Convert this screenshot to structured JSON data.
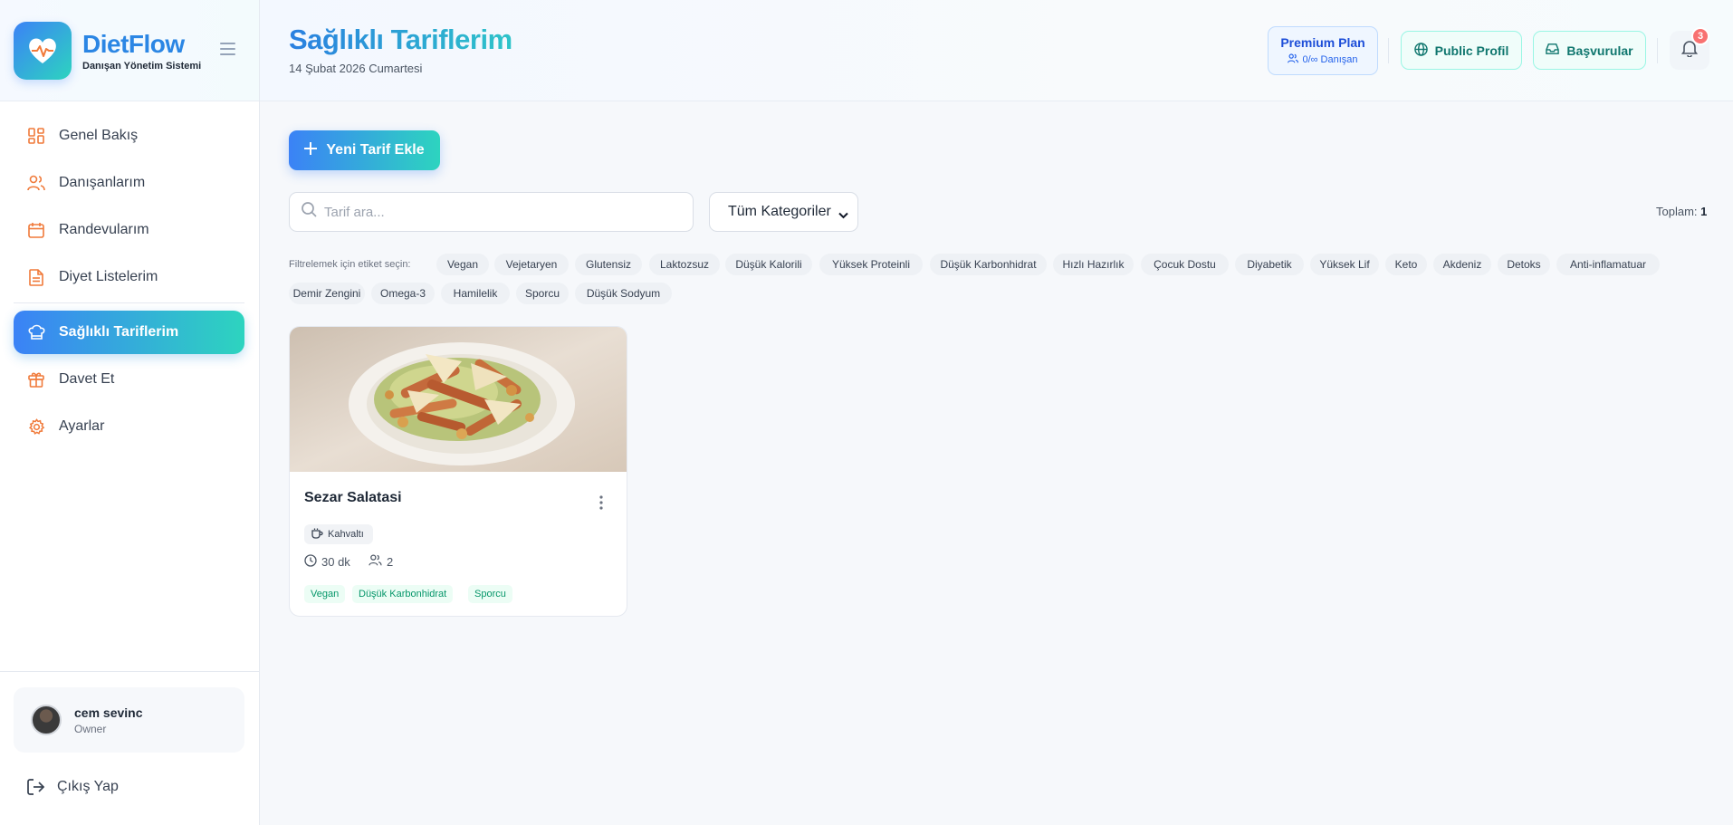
{
  "app": {
    "name": "DietFlow",
    "subtitle": "Danışan Yönetim Sistemi"
  },
  "sidebar": {
    "items": [
      {
        "label": "Genel Bakış",
        "icon": "dashboard-icon"
      },
      {
        "label": "Danışanlarım",
        "icon": "users-icon"
      },
      {
        "label": "Randevularım",
        "icon": "calendar-icon"
      },
      {
        "label": "Diyet Listelerim",
        "icon": "document-icon"
      },
      {
        "label": "Sağlıklı Tariflerim",
        "icon": "chef-hat-icon",
        "active": true
      },
      {
        "label": "Davet Et",
        "icon": "gift-icon"
      },
      {
        "label": "Ayarlar",
        "icon": "gear-icon"
      }
    ],
    "user": {
      "name": "cem sevinc",
      "role": "Owner"
    },
    "logout_label": "Çıkış Yap"
  },
  "header": {
    "title": "Sağlıklı Tariflerim",
    "date": "14 Şubat 2026 Cumartesi",
    "premium": {
      "title": "Premium Plan",
      "sub": "0/∞ Danışan"
    },
    "public_profile_label": "Public Profil",
    "applications_label": "Başvurular",
    "notification_count": "3"
  },
  "toolbar": {
    "add_label": "Yeni Tarif Ekle",
    "search_placeholder": "Tarif ara...",
    "category_selected": "Tüm Kategoriler",
    "total_label": "Toplam:",
    "total_value": "1"
  },
  "filters": {
    "label": "Filtrelemek için etiket seçin:",
    "tags": [
      "Vegan",
      "Vejetaryen",
      "Glutensiz",
      "Laktozsuz",
      "Düşük Kalorili",
      "Yüksek Proteinli",
      "Düşük Karbonhidrat",
      "Hızlı Hazırlık",
      "Çocuk Dostu",
      "Diyabetik",
      "Yüksek Lif",
      "Keto",
      "Akdeniz",
      "Detoks",
      "Anti-inflamatuar",
      "Demir Zengini",
      "Omega-3",
      "Hamilelik",
      "Sporcu",
      "Düşük Sodyum"
    ]
  },
  "recipes": [
    {
      "title": "Sezar Salatasi",
      "category": "Kahvaltı",
      "time": "30 dk",
      "servings": "2",
      "tags": [
        "Vegan",
        "Düşük Karbonhidrat",
        "Sporcu"
      ]
    }
  ],
  "colors": {
    "accent_start": "#3b82f6",
    "accent_end": "#2dd4bf",
    "icon_orange": "#f07a3a",
    "tag_green": "#059669",
    "badge_red": "#f87171"
  }
}
